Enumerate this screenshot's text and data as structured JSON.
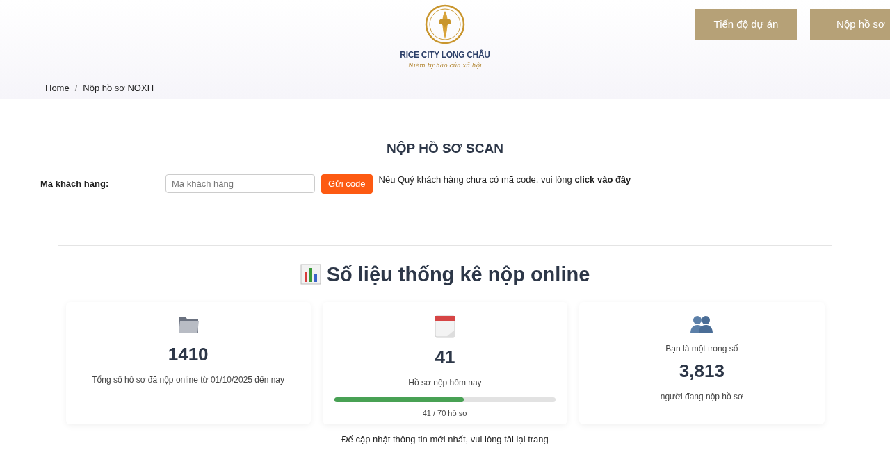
{
  "header": {
    "logo": {
      "name": "RICE CITY LONG CHÂU",
      "tagline": "Niềm tự hào của xã hội"
    },
    "nav_buttons": [
      "Tiến độ dự án",
      "Nộp hồ sơ"
    ]
  },
  "breadcrumb": {
    "separator": "/",
    "items": [
      "Home",
      "Nộp hồ sơ NOXH"
    ]
  },
  "form": {
    "title": "NỘP HỒ SƠ SCAN",
    "label": "Mã khách hàng:",
    "placeholder": "Mã khách hàng",
    "button": "Gửi code",
    "note": "Nếu Quý khách hàng chưa có mã code, vui lòng **click vào đây**"
  },
  "stats": {
    "title": "Số liệu thống kê nộp online",
    "cards": [
      {
        "kind": "count",
        "value": "1410",
        "caption": "Tổng số hồ sơ đã nộp online từ 01/10/2025 đến nay"
      },
      {
        "kind": "progress",
        "value": "41",
        "caption": "Hồ sơ nộp hôm nay",
        "level": 0.586,
        "reading": "41 / 70 hồ sơ"
      },
      {
        "kind": "community",
        "intro": "Bạn là một trong số",
        "value": "3,813",
        "caption": "người đang nộp hồ sơ"
      }
    ],
    "footnote": "Để cập nhật thông tin mới nhất, vui lòng tải lại trang"
  }
}
